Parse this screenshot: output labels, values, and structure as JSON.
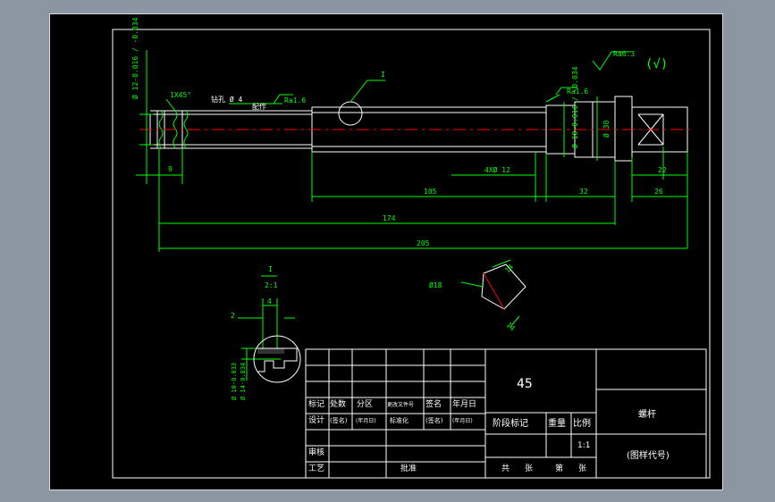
{
  "colors": {
    "background": "#000000",
    "outline": "#ffffff",
    "dimension": "#00ff00",
    "centerline": "#ff0000",
    "note": "#ffffff"
  },
  "top": {
    "roughness_general": "Ra6.3",
    "roughness_symbol": "(√)",
    "dia_top_tol": "Ø 12-0.016 / -0.034",
    "chamfer": "1X45°",
    "drill_hole": "钻孔 Ø 4",
    "fit_note": "配作",
    "ra_left": "Ra1.6",
    "detail_ref": "I",
    "ra_right": "Ra1.6",
    "dia_step_tol": "Ø 18-0.016 / -0.034",
    "dia_collar": "Ø 30"
  },
  "dims": {
    "d9": "9",
    "d4x12": "4XØ 12",
    "d105": "105",
    "d32": "32",
    "d22": "22",
    "d26": "26",
    "d174": "174",
    "d205": "205"
  },
  "detail": {
    "label": "I",
    "scale": "2:1",
    "d4": "4",
    "d2": "2",
    "tol_a": "Ø 10-0.033",
    "tol_b": "Ø 14-0.034"
  },
  "section": {
    "dia": "Ø18",
    "w1": "14",
    "w2": "14"
  },
  "title_block": {
    "material": "45",
    "part_name": "螺杆",
    "drawing_no": "(图样代号)",
    "row_mark": [
      "标记",
      "处数",
      "分区",
      "更改文件号",
      "签名",
      "年月日"
    ],
    "row_design": [
      "设计",
      "(签名)",
      "(年月日)",
      "标准化",
      "(签名)",
      "(年月日)"
    ],
    "stage_mark": "阶段标记",
    "weight": "重量",
    "ratio": "比例",
    "ratio_value": "1:1",
    "review": "审核",
    "process": "工艺",
    "approve": "批准",
    "total": "共",
    "sheets": "张",
    "page": "第",
    "sheets2": "张"
  }
}
